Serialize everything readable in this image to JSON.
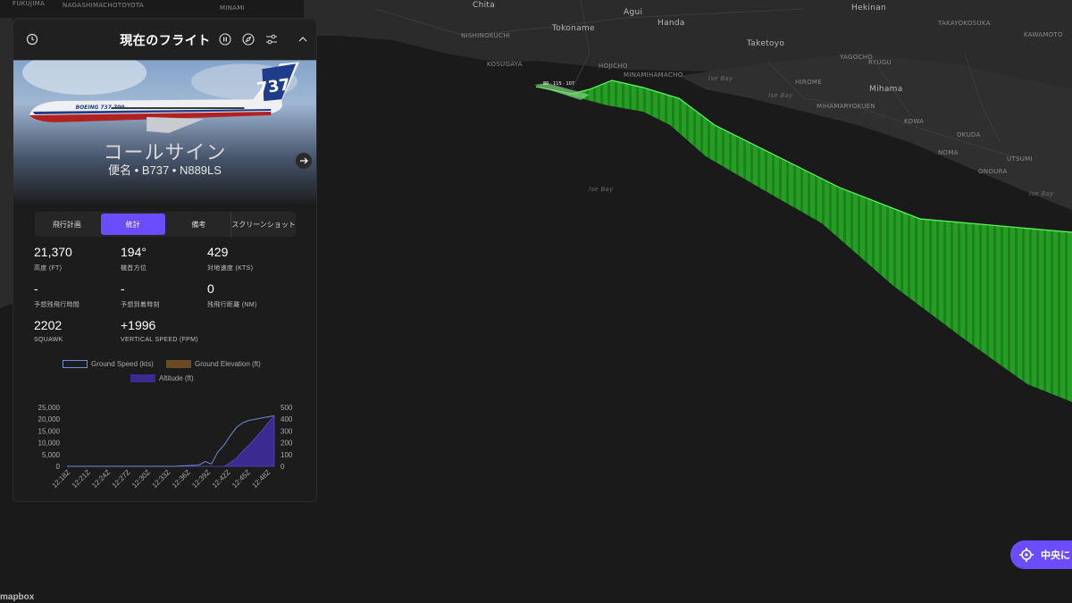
{
  "panel": {
    "title": "現在のフライト",
    "callsign": "コールサイン",
    "subline": "便名 • B737 • N889LS",
    "tabs": [
      {
        "label": "飛行計画",
        "active": false
      },
      {
        "label": "統計",
        "active": true
      },
      {
        "label": "備考",
        "active": false
      },
      {
        "label": "スクリーンショット",
        "active": false
      }
    ],
    "stats": [
      {
        "value": "21,370",
        "label": "高度 (FT)"
      },
      {
        "value": "194°",
        "label": "機首方位"
      },
      {
        "value": "429",
        "label": "対地速度 (KTS)"
      },
      {
        "value": "-",
        "label": "予想残飛行時間"
      },
      {
        "value": "-",
        "label": "予想到着時刻"
      },
      {
        "value": "0",
        "label": "残飛行距離 (NM)"
      },
      {
        "value": "2202",
        "label": "SQUAWK"
      },
      {
        "value": "+1996",
        "label": "VERTICAL SPEED (FPM)"
      }
    ]
  },
  "chart_data": {
    "type": "line",
    "legend": [
      "Ground Speed (kts)",
      "Ground Elevation (ft)",
      "Altitude (ft)"
    ],
    "left_ticks": [
      "25,000",
      "20,000",
      "15,000",
      "10,000",
      "5,000",
      "0"
    ],
    "right_ticks": [
      "500",
      "400",
      "300",
      "200",
      "100",
      "0"
    ],
    "x_ticks": [
      "12:18Z",
      "12:21Z",
      "12:24Z",
      "12:27Z",
      "12:30Z",
      "12:33Z",
      "12:36Z",
      "12:39Z",
      "12:42Z",
      "12:45Z",
      "12:48Z"
    ],
    "ylim_left": [
      0,
      25000
    ],
    "ylim_right": [
      0,
      500
    ],
    "series": [
      {
        "name": "Altitude (ft)",
        "color": "#3b2a8f",
        "x_minutes": [
          0,
          22,
          24,
          25,
          26,
          27,
          28,
          29,
          30,
          31,
          32,
          33
        ],
        "values": [
          0,
          0,
          0,
          0,
          1500,
          3500,
          6500,
          9000,
          12000,
          15000,
          18500,
          21370
        ]
      },
      {
        "name": "Ground Speed (kts)",
        "color": "#6d8bd8",
        "x_minutes": [
          0,
          17,
          19,
          21,
          22,
          23,
          24,
          25,
          26,
          27,
          28,
          29,
          30,
          31,
          32,
          33
        ],
        "values": [
          0,
          0,
          5,
          10,
          40,
          20,
          120,
          180,
          260,
          330,
          370,
          390,
          400,
          410,
          420,
          429
        ]
      }
    ]
  },
  "map": {
    "labels": [
      {
        "text": "FUKUJIMA",
        "cls": ""
      },
      {
        "text": "NAGASHIMACHOTOYOTA",
        "cls": ""
      },
      {
        "text": "MINAMI",
        "cls": ""
      },
      {
        "text": "Chita",
        "cls": "big"
      },
      {
        "text": "Agui",
        "cls": "big"
      },
      {
        "text": "Handa",
        "cls": "big"
      },
      {
        "text": "Hekinan",
        "cls": "big"
      },
      {
        "text": "Tokoname",
        "cls": "big"
      },
      {
        "text": "Taketoyo",
        "cls": "big"
      },
      {
        "text": "Mihama",
        "cls": "big"
      },
      {
        "text": "Ise Bay",
        "cls": "water"
      },
      {
        "text": "Ise Bay",
        "cls": "water"
      },
      {
        "text": "Ise Bay",
        "cls": "water"
      },
      {
        "text": "Ise Bay",
        "cls": "water"
      },
      {
        "text": "NISHINOKUCHI",
        "cls": ""
      },
      {
        "text": "KOSUGAYA",
        "cls": ""
      },
      {
        "text": "HOJICHO",
        "cls": ""
      },
      {
        "text": "MINAMIHAMACHO",
        "cls": ""
      },
      {
        "text": "HIROME",
        "cls": ""
      },
      {
        "text": "KOWA",
        "cls": ""
      },
      {
        "text": "OKUDA",
        "cls": ""
      },
      {
        "text": "NOMA",
        "cls": ""
      },
      {
        "text": "ONOURA",
        "cls": ""
      },
      {
        "text": "UTSUMI",
        "cls": ""
      },
      {
        "text": "YAGOCHO",
        "cls": ""
      },
      {
        "text": "TAKAYOKOSUKA",
        "cls": ""
      },
      {
        "text": "MIHAMARYOKUEN",
        "cls": ""
      },
      {
        "text": "RYUGU",
        "cls": ""
      },
      {
        "text": "KAWAMOTO",
        "cls": ""
      }
    ]
  },
  "footer": {
    "brand": "mapbox"
  },
  "center_button": {
    "label": "中央に"
  }
}
